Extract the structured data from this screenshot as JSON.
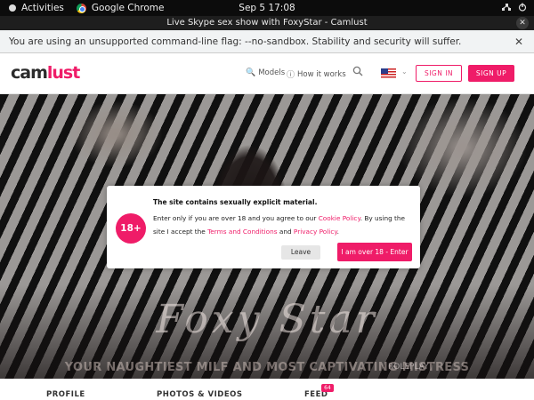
{
  "gnome": {
    "activities": "Activities",
    "app_name": "Google Chrome",
    "clock": "Sep 5  17:08"
  },
  "window": {
    "title": "Live Skype sex show with FoxyStar - Camlust",
    "close_glyph": "✕"
  },
  "infobar": {
    "message": "You are using an unsupported command-line flag: --no-sandbox. Stability and security will suffer.",
    "close_glyph": "✕"
  },
  "site": {
    "logo_part1": "cam",
    "logo_part2": "lust",
    "nav": {
      "models_icon": "🔍",
      "models": "Models",
      "how_icon": "ⓘ",
      "how": "How it works",
      "search_icon": "⚲",
      "caret": "⌄"
    },
    "sign_in": "SIGN IN",
    "sign_up": "SIGN UP",
    "accent_color": "#ef1c68"
  },
  "hero": {
    "name": "Foxy Star",
    "tagline": "YOUR NAUGHTIEST MILF AND MOST CAPTIVATING MISTRESS",
    "watermark": "ROLEPLAY"
  },
  "tabs": {
    "profile": "PROFILE",
    "photos": "PHOTOS & VIDEOS",
    "feed": "FEED",
    "feed_badge": "64"
  },
  "modal": {
    "badge": "18+",
    "title": "The site contains sexually explicit material.",
    "body_1": "Enter only if you are over 18 and you agree to our ",
    "cookie_link": "Cookie Policy",
    "body_2": ". By using the site I accept the ",
    "terms_link": "Terms and Conditions",
    "body_3": " and ",
    "privacy_link": "Privacy Policy",
    "body_4": ".",
    "leave": "Leave",
    "enter": "I am over 18 - Enter"
  }
}
